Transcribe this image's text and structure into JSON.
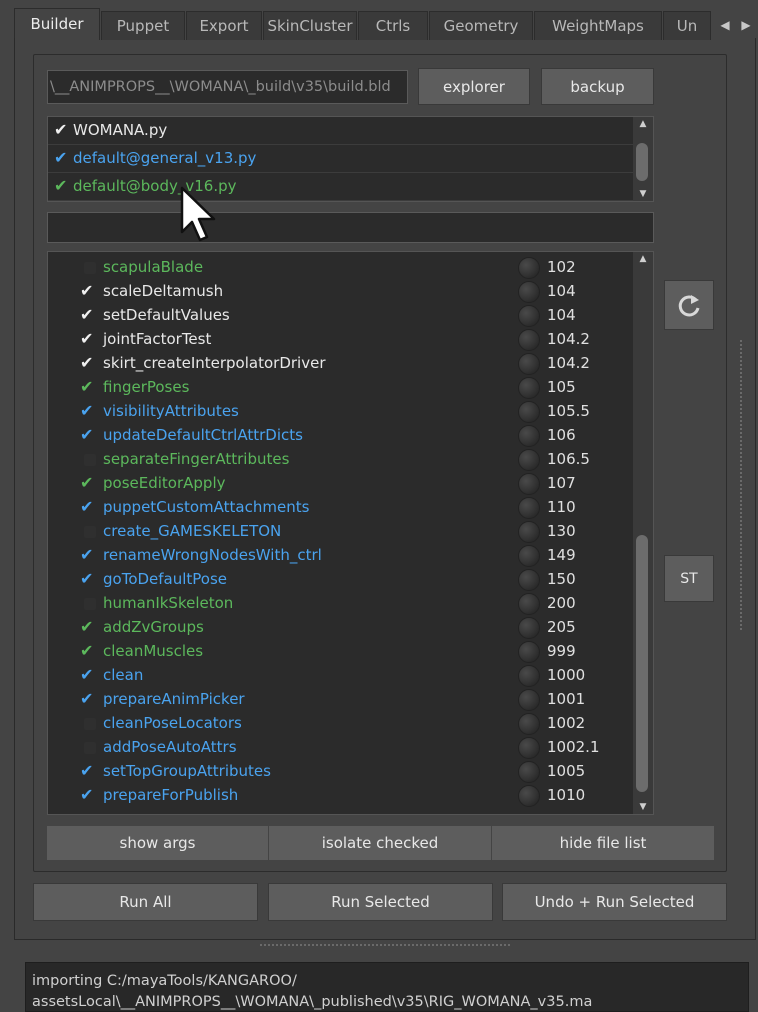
{
  "colors": {
    "white": "#e8e8e8",
    "blue": "#4aa3ef",
    "green": "#5cb85c",
    "check_white": "#f0f0f0",
    "check_blue": "#4aa3ef",
    "check_green": "#5cb85c"
  },
  "tabs": [
    {
      "label": "Builder"
    },
    {
      "label": "Puppet"
    },
    {
      "label": "Export"
    },
    {
      "label": "SkinCluster"
    },
    {
      "label": "Ctrls"
    },
    {
      "label": "Geometry"
    },
    {
      "label": "WeightMaps"
    },
    {
      "label": "Un"
    }
  ],
  "tab_arrows": {
    "left": "◀",
    "right": "▶"
  },
  "build_path": {
    "value": "\\__ANIMPROPS__\\WOMANA\\_build\\v35\\build.bld"
  },
  "buttons": {
    "explorer": "explorer",
    "backup": "backup",
    "refresh_icon": "refresh-icon",
    "st": "ST",
    "show_args": "show args",
    "isolate_checked": "isolate checked",
    "hide_file_list": "hide file list",
    "run_all": "Run All",
    "run_selected": "Run Selected",
    "undo_run_selected": "Undo + Run Selected"
  },
  "files": [
    {
      "name": "WOMANA.py",
      "checked": true,
      "color": "white"
    },
    {
      "name": "default@general_v13.py",
      "checked": true,
      "color": "blue"
    },
    {
      "name": "default@body_v16.py",
      "checked": true,
      "color": "green"
    }
  ],
  "filter": {
    "value": ""
  },
  "steps": [
    {
      "name": "scapulaBlade",
      "order": "102",
      "checked": false,
      "color": "green"
    },
    {
      "name": "scaleDeltamush",
      "order": "104",
      "checked": true,
      "color": "white"
    },
    {
      "name": "setDefaultValues",
      "order": "104",
      "checked": true,
      "color": "white"
    },
    {
      "name": "jointFactorTest",
      "order": "104.2",
      "checked": true,
      "color": "white"
    },
    {
      "name": "skirt_createInterpolatorDriver",
      "order": "104.2",
      "checked": true,
      "color": "white"
    },
    {
      "name": "fingerPoses",
      "order": "105",
      "checked": true,
      "color": "green"
    },
    {
      "name": "visibilityAttributes",
      "order": "105.5",
      "checked": true,
      "color": "blue"
    },
    {
      "name": "updateDefaultCtrlAttrDicts",
      "order": "106",
      "checked": true,
      "color": "blue"
    },
    {
      "name": "separateFingerAttributes",
      "order": "106.5",
      "checked": false,
      "color": "green"
    },
    {
      "name": "poseEditorApply",
      "order": "107",
      "checked": true,
      "color": "green"
    },
    {
      "name": "puppetCustomAttachments",
      "order": "110",
      "checked": true,
      "color": "blue"
    },
    {
      "name": "create_GAMESKELETON",
      "order": "130",
      "checked": false,
      "color": "blue"
    },
    {
      "name": "renameWrongNodesWith_ctrl",
      "order": "149",
      "checked": true,
      "color": "blue"
    },
    {
      "name": "goToDefaultPose",
      "order": "150",
      "checked": true,
      "color": "blue"
    },
    {
      "name": "humanIkSkeleton",
      "order": "200",
      "checked": false,
      "color": "green"
    },
    {
      "name": "addZvGroups",
      "order": "205",
      "checked": true,
      "color": "green"
    },
    {
      "name": "cleanMuscles",
      "order": "999",
      "checked": true,
      "color": "green"
    },
    {
      "name": "clean",
      "order": "1000",
      "checked": true,
      "color": "blue"
    },
    {
      "name": "prepareAnimPicker",
      "order": "1001",
      "checked": true,
      "color": "blue"
    },
    {
      "name": "cleanPoseLocators",
      "order": "1002",
      "checked": false,
      "color": "blue"
    },
    {
      "name": "addPoseAutoAttrs",
      "order": "1002.1",
      "checked": false,
      "color": "blue"
    },
    {
      "name": "setTopGroupAttributes",
      "order": "1005",
      "checked": true,
      "color": "blue"
    },
    {
      "name": "prepareForPublish",
      "order": "1010",
      "checked": true,
      "color": "blue"
    }
  ],
  "console": {
    "line1": "importing C:/mayaTools/KANGAROO/",
    "line2": "assetsLocal\\__ANIMPROPS__\\WOMANA\\_published\\v35\\RIG_WOMANA_v35.ma"
  },
  "cursor_icon": "mouse-pointer-icon"
}
